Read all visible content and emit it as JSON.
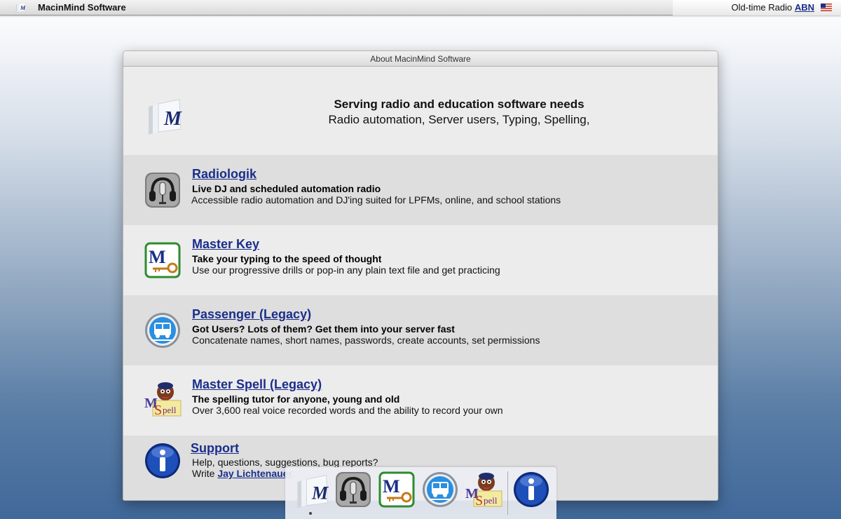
{
  "menubar": {
    "app_name": "MacinMind Software",
    "right_label": "Old-time Radio ",
    "right_link": "ABN",
    "flag_icon": "us-flag-icon"
  },
  "window": {
    "title": "About MacinMind Software"
  },
  "hero": {
    "headline": "Serving radio and education software needs",
    "tagline": "Radio automation, Server users, Typing, Spelling,"
  },
  "products": [
    {
      "title": "Radiologik",
      "subtitle": "Live DJ and scheduled automation radio",
      "description": "Accessible radio automation and DJ'ing suited for LPFMs, online, and school stations",
      "icon": "headphones-mic-icon"
    },
    {
      "title": "Master Key",
      "subtitle": "Take your typing to the speed of thought",
      "description": "Use our progressive drills or pop-in any plain text file and get practicing",
      "icon": "master-key-icon"
    },
    {
      "title": "Passenger (Legacy)",
      "subtitle": "Got Users? Lots of them? Get them into your server fast",
      "description": "Concatenate names, short names, passwords, create accounts, set permissions",
      "icon": "bus-icon"
    },
    {
      "title": "Master Spell (Legacy)",
      "subtitle": "The spelling tutor for anyone, young and old",
      "description": "Over 3,600 real voice recorded words and the ability to record your own",
      "icon": "master-spell-icon"
    }
  ],
  "support": {
    "title": "Support",
    "line1": "Help, questions, suggestions, bug reports?",
    "write_prefix": "Write ",
    "contact_name": "Jay Lichtenauer",
    "write_suffix": ".",
    "icon": "info-icon"
  },
  "dock": {
    "items": [
      "macinmind-logo-icon",
      "headphones-mic-icon",
      "master-key-icon",
      "bus-icon",
      "master-spell-icon",
      "info-icon"
    ]
  },
  "colors": {
    "link": "#1a2e8a",
    "row_shade": "#dedede",
    "row_light": "#ececec",
    "info_blue": "#1f4fb8",
    "bus_blue": "#2a8fe0"
  }
}
